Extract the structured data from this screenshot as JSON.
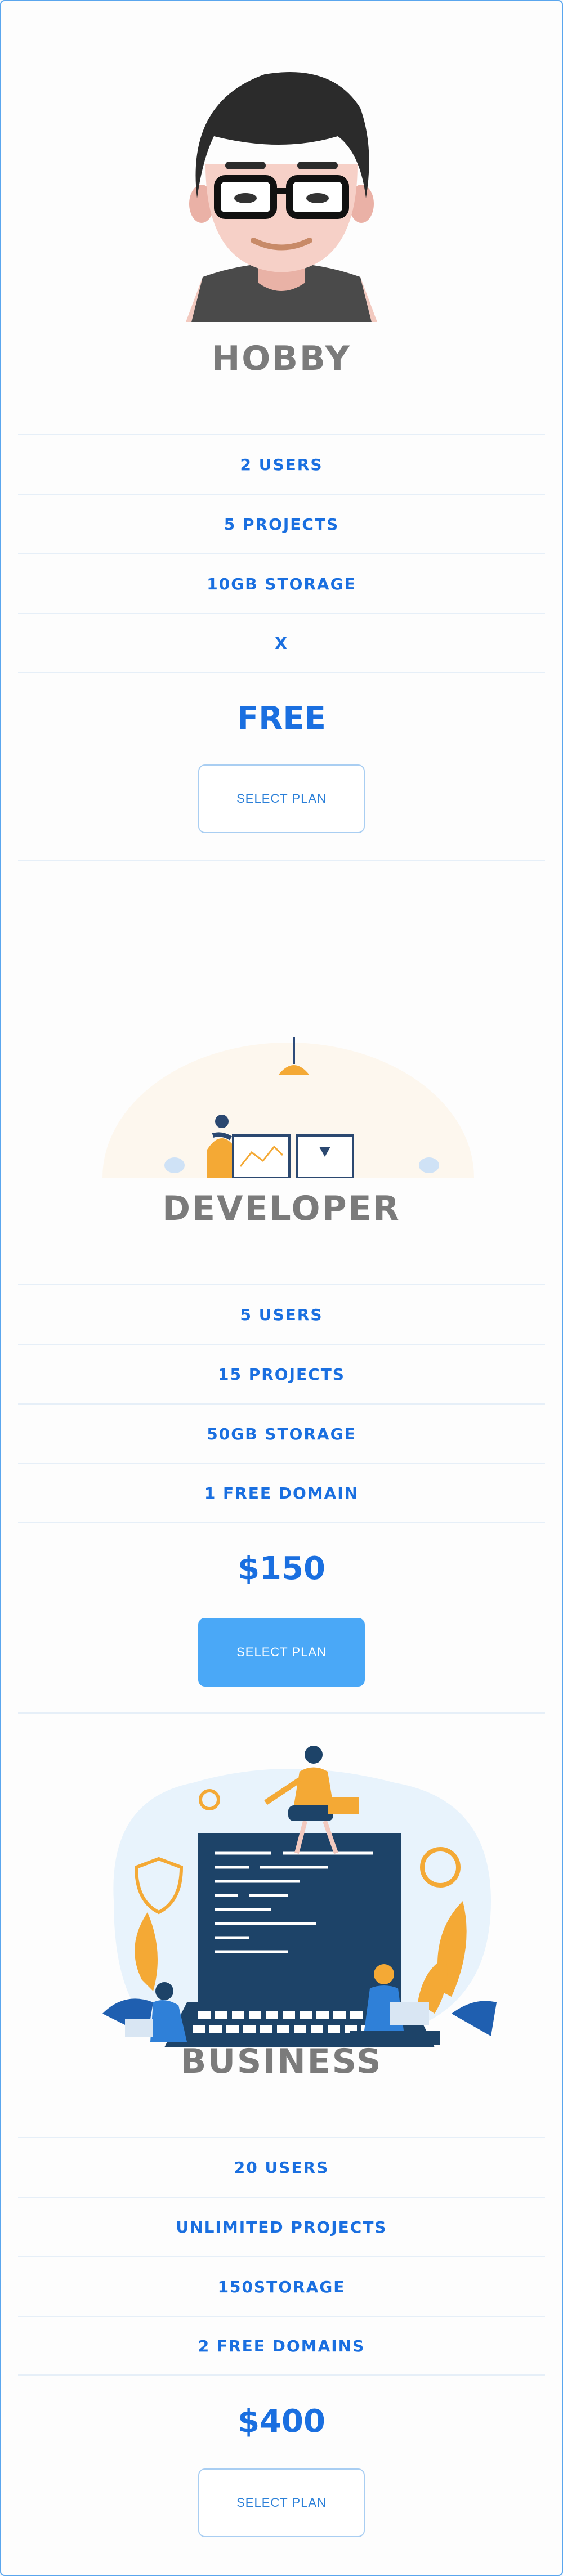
{
  "plans": [
    {
      "title": "HOBBY",
      "features": [
        "2 USERS",
        "5 PROJECTS",
        "10GB STORAGE",
        "X"
      ],
      "price": "FREE",
      "button": "SELECT PLAN"
    },
    {
      "title": "DEVELOPER",
      "features": [
        "5 USERS",
        "15 PROJECTS",
        "50GB STORAGE",
        "1 FREE DOMAIN"
      ],
      "price": "$150",
      "button": "SELECT PLAN"
    },
    {
      "title": "BUSINESS",
      "features": [
        "20 USERS",
        "UNLIMITED PROJECTS",
        "150STORAGE",
        "2 FREE DOMAINS"
      ],
      "price": "$400",
      "button": "SELECT PLAN"
    }
  ],
  "colors": {
    "accent": "#1a6fe0",
    "button_fill": "#4aa8f7",
    "title_gray": "#7b7b7b"
  }
}
